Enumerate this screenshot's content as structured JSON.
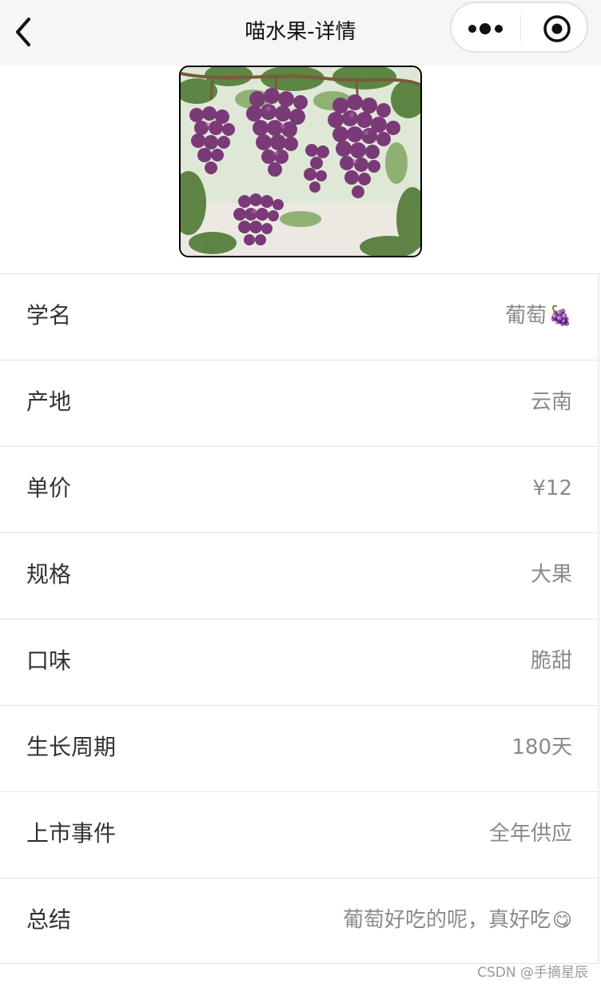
{
  "navbar": {
    "title": "喵水果-详情",
    "back_icon": "chevron-left-icon",
    "more_icon": "more-dots-icon",
    "close_icon": "target-circle-icon"
  },
  "hero": {
    "subject": "grape-photo",
    "colors": {
      "grape": "#7a3a78",
      "leaf": "#4f7a35",
      "sky": "#e9efe4"
    }
  },
  "details": [
    {
      "label": "学名",
      "value": "葡萄",
      "emoji": "🍇"
    },
    {
      "label": "产地",
      "value": "云南",
      "emoji": ""
    },
    {
      "label": "单价",
      "value": "¥12",
      "emoji": ""
    },
    {
      "label": "规格",
      "value": "大果",
      "emoji": ""
    },
    {
      "label": "口味",
      "value": "脆甜",
      "emoji": ""
    },
    {
      "label": "生长周期",
      "value": "180天",
      "emoji": ""
    },
    {
      "label": "上市事件",
      "value": "全年供应",
      "emoji": ""
    },
    {
      "label": "总结",
      "value": "葡萄好吃的呢，真好吃",
      "emoji": "😋"
    }
  ],
  "watermark": "CSDN @手摘星辰"
}
